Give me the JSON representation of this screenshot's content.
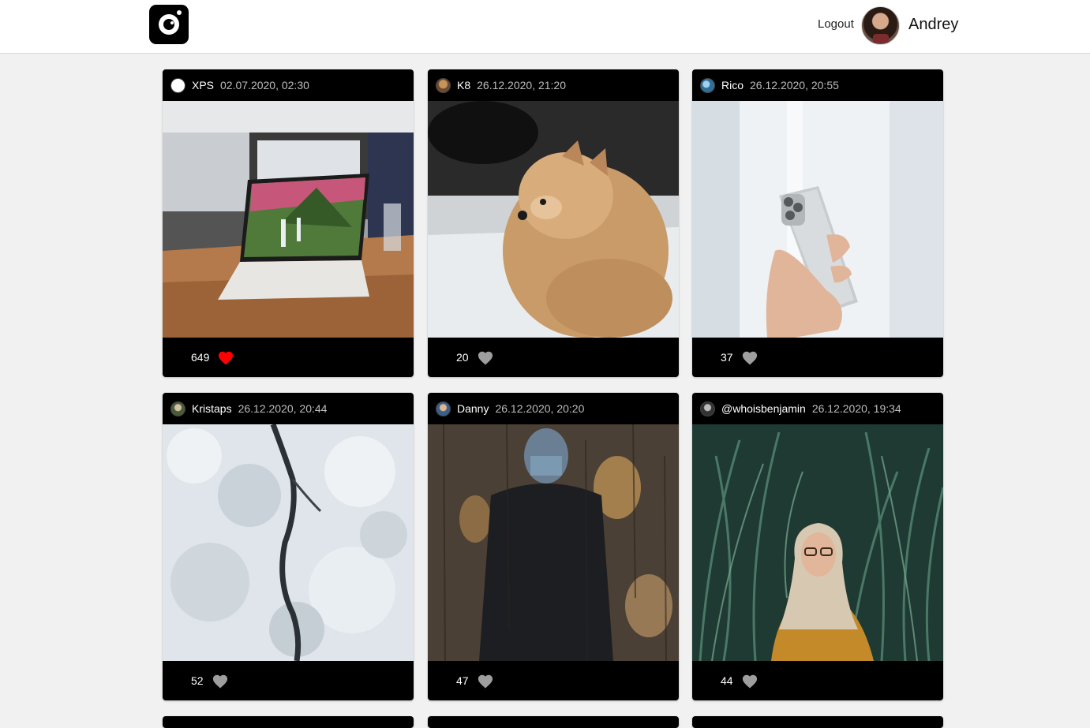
{
  "header": {
    "logout_label": "Logout",
    "user_name": "Andrey"
  },
  "posts": [
    {
      "user": "XPS",
      "date": "02.07.2020, 02:30",
      "likes": "649",
      "liked": true,
      "photo": "laptop on table in office"
    },
    {
      "user": "K8",
      "date": "26.12.2020, 21:20",
      "likes": "20",
      "liked": false,
      "photo": "fluffy pomeranian dog"
    },
    {
      "user": "Rico",
      "date": "26.12.2020, 20:55",
      "likes": "37",
      "liked": false,
      "photo": "hand holding silver phone"
    },
    {
      "user": "Kristaps",
      "date": "26.12.2020, 20:44",
      "likes": "52",
      "liked": false,
      "photo": "aerial view of snowy forest"
    },
    {
      "user": "Danny",
      "date": "26.12.2020, 20:20",
      "likes": "47",
      "liked": false,
      "photo": "person behind rainy glass"
    },
    {
      "user": "@whoisbenjamin",
      "date": "26.12.2020, 19:34",
      "likes": "44",
      "liked": false,
      "photo": "woman in tall grass"
    }
  ],
  "colors": {
    "liked_heart": "#ff0000",
    "unliked_heart": "#9e9e9e",
    "card_background": "#000000",
    "page_background": "#f1f1f1"
  }
}
